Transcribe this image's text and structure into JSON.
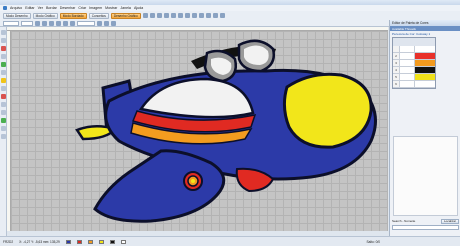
{
  "menu": {
    "items": [
      "Arquivo",
      "Editar",
      "Ver",
      "Bordar",
      "Desenhar",
      "Criar",
      "Imagem",
      "Mostrar",
      "Janela",
      "Ajuda"
    ]
  },
  "toolbar1": {
    "mode_label": "Modo Desenho",
    "tab1": "Modo Gráfico",
    "tab2": "Modo Bordado",
    "tab3": "Conceitos",
    "active_tool": "Desenho Gráfico"
  },
  "panel": {
    "title": "Editor de Paleta de Cores",
    "available": "Available Threads",
    "palette": "Pa lecura de Cor: Coloway 1",
    "threads": [
      {
        "num": "",
        "label": "",
        "color": "#ffffff"
      },
      {
        "num": "2",
        "label": "",
        "color": "#e8302a"
      },
      {
        "num": "3",
        "label": "",
        "color": "#f39a1e"
      },
      {
        "num": "4",
        "label": "",
        "color": "#111111"
      },
      {
        "num": "5",
        "label": "",
        "color": "#f0e11a"
      },
      {
        "num": "6",
        "label": "",
        "color": "#ffffff"
      }
    ],
    "footer_label": "Search - Nomeite",
    "footer_button": "Localizar"
  },
  "status": {
    "left": "FR2D2",
    "coords": "X: -4,27 Y: -5,63 mm: 135,29",
    "right": "Salto: 0/0"
  },
  "colors": {
    "body": "#2c3aa8",
    "outline": "#0c0f2a",
    "red": "#e02a22",
    "orange": "#f39c1f",
    "yellow": "#f2e61a",
    "white": "#f2f2f2",
    "gray": "#9a9a9a"
  }
}
